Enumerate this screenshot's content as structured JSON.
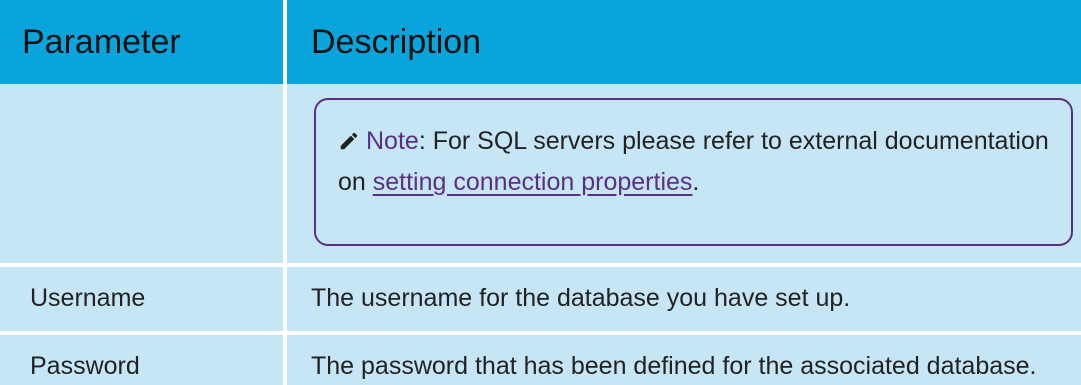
{
  "table": {
    "headers": {
      "parameter": "Parameter",
      "description": "Description"
    },
    "note_row": {
      "parameter": "",
      "note": {
        "icon": "pencil-icon",
        "label": "Note",
        "separator": ": ",
        "text_before_link": "For SQL servers please refer to external documentation on ",
        "link_text": "setting connection properties",
        "text_after_link": "."
      }
    },
    "rows": [
      {
        "parameter": "Username",
        "description": "The username for the database you have set up."
      },
      {
        "parameter": "Password",
        "description": "The password that has been defined for the associated database."
      }
    ]
  },
  "colors": {
    "header_background": "#0aa4dc",
    "row_background": "#c6e6f6",
    "note_accent": "#5b2f86"
  }
}
